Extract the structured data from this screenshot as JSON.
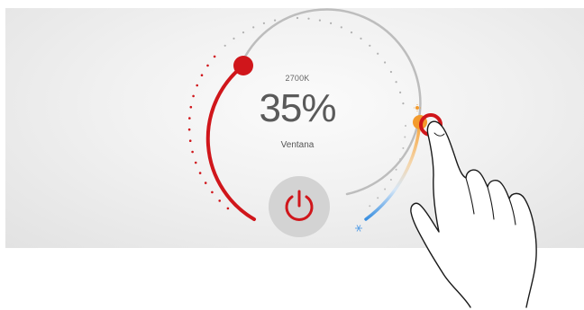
{
  "dimmer": {
    "color_temperature": "2700K",
    "brightness": "35%",
    "brightness_value": 0.35,
    "room": "Ventana"
  },
  "controls": {
    "power_icon": "power-icon",
    "sun_icon": "sun-icon",
    "snowflake_icon": "snowflake-icon"
  },
  "colors": {
    "accent_red": "#d0161b",
    "warm_orange": "#f39a2c",
    "cool_blue": "#3a8fe0",
    "track_gray": "#b8b8b8"
  }
}
